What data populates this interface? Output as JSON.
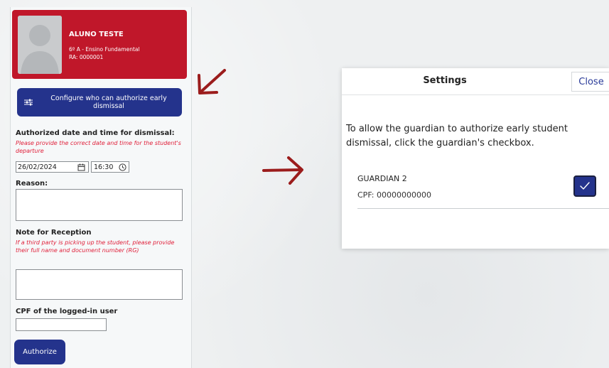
{
  "student": {
    "name": "ALUNO TESTE",
    "class": "6º A - Ensino Fundamental",
    "ra": "RA: 0000001"
  },
  "form": {
    "configure_button": "Configure who can authorize early dismissal",
    "datetime_label": "Authorized date and time for dismissal:",
    "datetime_hint": "Please provide the correct date and time for the student's departure",
    "date_value": "26/02/2024",
    "time_value": "16:30",
    "reason_label": "Reason:",
    "note_label": "Note for Reception",
    "note_hint": "If a third party is picking up the student, please provide their full name and document number (RG)",
    "cpf_label": "CPF of the logged-in user",
    "authorize_button": "Authorize"
  },
  "dialog": {
    "title": "Settings",
    "close_label": "Close",
    "message": "To allow the guardian to authorize early student dismissal, click the guardian's checkbox.",
    "guardian": {
      "name": "GUARDIAN 2",
      "cpf": "CPF: 00000000000",
      "checked": true
    }
  },
  "colors": {
    "card_red": "#c0172a",
    "primary_blue": "#24338c",
    "hint_red": "#e0203a",
    "arrow_red": "#9b1c1c"
  },
  "icons": [
    "tune-icon",
    "calendar-icon",
    "clock-icon",
    "check-icon",
    "avatar-placeholder"
  ]
}
